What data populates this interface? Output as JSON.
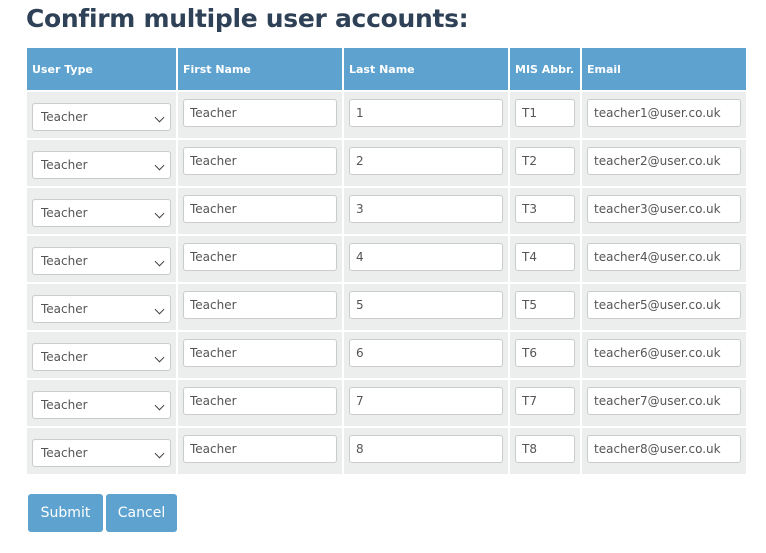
{
  "page": {
    "title": "Confirm multiple user accounts:"
  },
  "table": {
    "headers": [
      "User Type",
      "First Name",
      "Last Name",
      "MIS Abbr.",
      "Email"
    ],
    "rows": [
      {
        "user_type": "Teacher",
        "first_name": "Teacher",
        "last_name": "1",
        "mis": "T1",
        "email": "teacher1@user.co.uk"
      },
      {
        "user_type": "Teacher",
        "first_name": "Teacher",
        "last_name": "2",
        "mis": "T2",
        "email": "teacher2@user.co.uk"
      },
      {
        "user_type": "Teacher",
        "first_name": "Teacher",
        "last_name": "3",
        "mis": "T3",
        "email": "teacher3@user.co.uk"
      },
      {
        "user_type": "Teacher",
        "first_name": "Teacher",
        "last_name": "4",
        "mis": "T4",
        "email": "teacher4@user.co.uk"
      },
      {
        "user_type": "Teacher",
        "first_name": "Teacher",
        "last_name": "5",
        "mis": "T5",
        "email": "teacher5@user.co.uk"
      },
      {
        "user_type": "Teacher",
        "first_name": "Teacher",
        "last_name": "6",
        "mis": "T6",
        "email": "teacher6@user.co.uk"
      },
      {
        "user_type": "Teacher",
        "first_name": "Teacher",
        "last_name": "7",
        "mis": "T7",
        "email": "teacher7@user.co.uk"
      },
      {
        "user_type": "Teacher",
        "first_name": "Teacher",
        "last_name": "8",
        "mis": "T8",
        "email": "teacher8@user.co.uk"
      }
    ]
  },
  "buttons": {
    "submit": "Submit",
    "cancel": "Cancel"
  },
  "colors": {
    "accent": "#5ea3d0",
    "title": "#2e4157",
    "row_bg": "#eceeee"
  }
}
